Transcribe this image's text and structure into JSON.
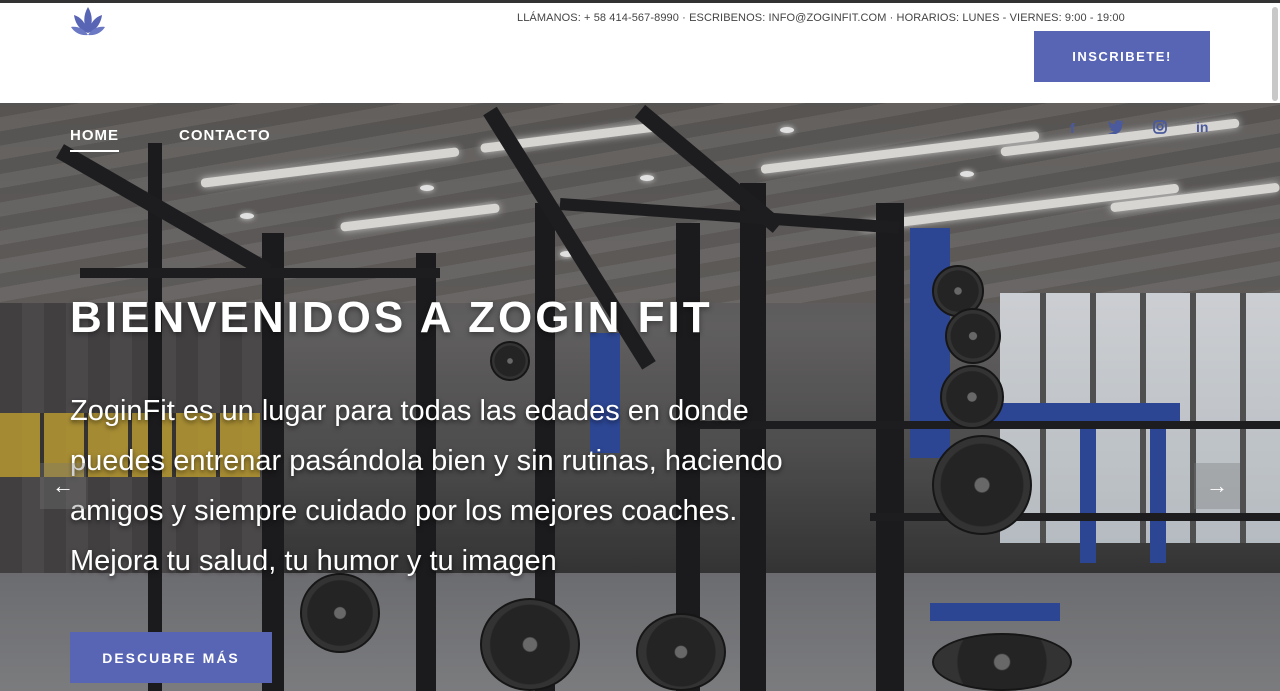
{
  "header": {
    "logo_icon": "lotus-icon",
    "contact_line": "LLÁMANOS: + 58 414-567-8990 · ESCRIBENOS: INFO@ZOGINFIT.COM · HORARIOS: LUNES - VIERNES: 9:00 - 19:00",
    "cta_label": "INSCRIBETE!"
  },
  "nav": {
    "items": [
      {
        "label": "HOME",
        "active": true
      },
      {
        "label": "CONTACTO",
        "active": false
      }
    ]
  },
  "social": [
    {
      "icon": "facebook-icon",
      "glyph": "f"
    },
    {
      "icon": "twitter-icon",
      "glyph": "🐦"
    },
    {
      "icon": "instagram-icon",
      "glyph": "◎"
    },
    {
      "icon": "linkedin-icon",
      "glyph": "in"
    }
  ],
  "hero": {
    "title": "BIENVENIDOS A ZOGIN FIT",
    "text": "ZoginFit es un lugar para todas las edades en donde puedes entrenar pasándola bien y sin rutinas, haciendo amigos y siempre cuidado por los mejores coaches. Mejora tu salud, tu humor y tu imagen",
    "cta_label": "DESCUBRE MÁS",
    "prev_arrow": "←",
    "next_arrow": "→"
  },
  "colors": {
    "accent": "#5865b5",
    "social": "#4a5a9c"
  }
}
